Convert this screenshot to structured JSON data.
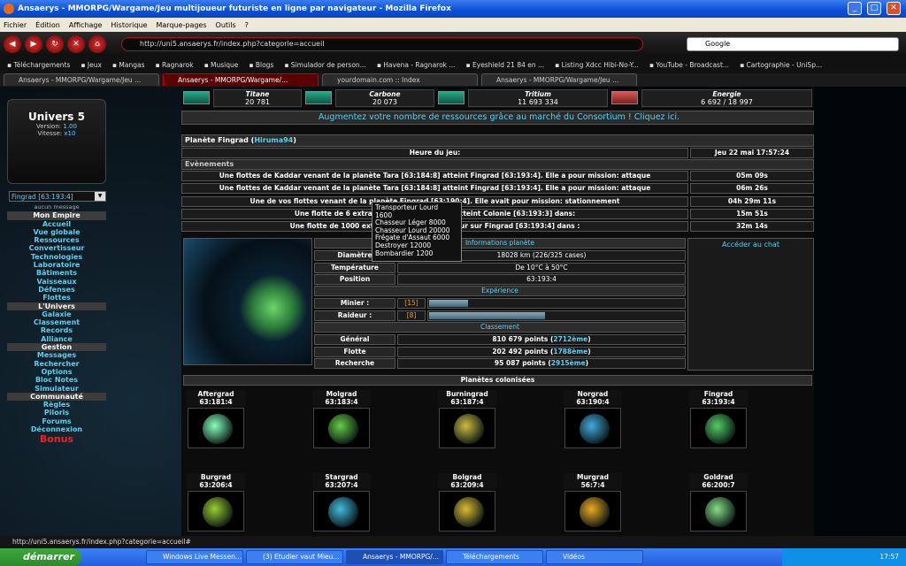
{
  "window": {
    "title": "Ansaerys - MMORPG/Wargame/Jeu multijoueur futuriste en ligne par navigateur - Mozilla Firefox"
  },
  "menu": [
    "Fichier",
    "Édition",
    "Affichage",
    "Historique",
    "Marque-pages",
    "Outils",
    "?"
  ],
  "url": "http://uni5.ansaerys.fr/index.php?categorie=accueil",
  "search_placeholder": "Google",
  "bookmarks": [
    "Téléchargements",
    "Jeux",
    "Mangas",
    "Ragnarok",
    "Musique",
    "Blogs",
    "Simulador de person...",
    "Havena - Ragnarok ...",
    "Eyeshield 21 84 en ...",
    "Listing Xdcc Hibi-No-Y...",
    "YouTube - Broadcast...",
    "Cartographie - UniSp..."
  ],
  "tabs": [
    "Ansaerys - MMORPG/Wargame/Jeu ...",
    "Ansaerys - MMORPG/Wargame/...",
    "yourdomain.com :: Index",
    "Ansaerys - MMORPG/Wargame/Jeu ..."
  ],
  "side": {
    "universe": "Univers 5",
    "version_label": "Version:",
    "version": "1.00",
    "speed_label": "Vitesse:",
    "speed": "x10",
    "planet_select": "Fingrad [63:193:4]",
    "no_message": "aucun message"
  },
  "nav": [
    {
      "t": "h",
      "l": "Mon Empire"
    },
    {
      "t": "i",
      "l": "Accueil"
    },
    {
      "t": "i",
      "l": "Vue globale"
    },
    {
      "t": "i",
      "l": "Ressources"
    },
    {
      "t": "i",
      "l": "Convertisseur"
    },
    {
      "t": "i",
      "l": "Technologies"
    },
    {
      "t": "i",
      "l": "Laboratoire"
    },
    {
      "t": "i",
      "l": "Bâtiments"
    },
    {
      "t": "i",
      "l": "Vaisseaux"
    },
    {
      "t": "i",
      "l": "Défenses"
    },
    {
      "t": "i",
      "l": "Flottes"
    },
    {
      "t": "h",
      "l": "L'Univers"
    },
    {
      "t": "i",
      "l": "Galaxie"
    },
    {
      "t": "i",
      "l": "Classement"
    },
    {
      "t": "i",
      "l": "Records"
    },
    {
      "t": "i",
      "l": "Alliance"
    },
    {
      "t": "h",
      "l": "Gestion"
    },
    {
      "t": "i",
      "l": "Messages"
    },
    {
      "t": "i",
      "l": "Rechercher"
    },
    {
      "t": "i",
      "l": "Options"
    },
    {
      "t": "i",
      "l": "Bloc Notes"
    },
    {
      "t": "i",
      "l": "Simulateur"
    },
    {
      "t": "h",
      "l": "Communauté"
    },
    {
      "t": "i",
      "l": "Règles"
    },
    {
      "t": "i",
      "l": "Piloris"
    },
    {
      "t": "i",
      "l": "Forums"
    },
    {
      "t": "i",
      "l": "Déconnexion"
    },
    {
      "t": "b",
      "l": "Bonus"
    }
  ],
  "resources": [
    {
      "name": "Titane",
      "value": "20 781"
    },
    {
      "name": "Carbone",
      "value": "20 073"
    },
    {
      "name": "Tritium",
      "value": "11 693 334"
    },
    {
      "name": "Energie",
      "value": "6 692 / 18 997"
    }
  ],
  "banner": "Augmentez votre nombre de ressources grâce au marché du Consortium ! Cliquez ici.",
  "planet_title": "Planète Fingrad",
  "planet_owner": "Hiruma94",
  "game_time_label": "Heure du jeu:",
  "game_time": "Jeu 22 mai 17:57:24",
  "events_label": "Evènements",
  "events": [
    {
      "text": "Une flottes de Kaddar venant de la planète Tara [63:184:8] atteint Fingrad [63:193:4]. Elle a pour mission: attaque",
      "time": "05m 09s"
    },
    {
      "text": "Une flottes de Kaddar venant de la planète Tara [63:184:8] atteint Fingrad [63:193:4]. Elle a pour mission: attaque",
      "time": "06m 26s"
    },
    {
      "text": "Une de vos flottes venant de la planète Fingrad [63:190:4]. Elle avait pour mission: stationnement",
      "time": "04h 29m 11s"
    },
    {
      "text": "Une flotte de 6 extracteurs ven [63:193:4] atteint Colonie [63:193:3] dans:",
      "time": "15m 51s"
    },
    {
      "text": "Une flotte de 1000 extracteurs p sera de retour sur Fingrad [63:193:4] dans :",
      "time": "32m 14s"
    }
  ],
  "tooltip": [
    "Transporteur Lourd",
    "1600",
    "Chasseur Léger 8000",
    "Chasseur Lourd 20000",
    "Frégate d'Assaut 6000",
    "Destroyer 12000",
    "Bombardier 1200"
  ],
  "info": {
    "header": "Informations planète",
    "rows": [
      {
        "l": "Diamètre",
        "v": "18028 km (226/325 cases)"
      },
      {
        "l": "Température",
        "v": "De 10°C à 50°C"
      },
      {
        "l": "Position",
        "v": "63:193:4"
      }
    ]
  },
  "experience": {
    "header": "Expérience",
    "rows": [
      {
        "l": "Minier :",
        "lv": "15",
        "fill": 0.15
      },
      {
        "l": "Raideur :",
        "lv": "8",
        "fill": 0.45
      }
    ]
  },
  "ranking": {
    "header": "Classement",
    "rows": [
      {
        "l": "Général",
        "pts": "810 679 points",
        "rank": "2712ème"
      },
      {
        "l": "Flotte",
        "pts": "202 492 points",
        "rank": "1788ème"
      },
      {
        "l": "Recherche",
        "pts": "95 087 points",
        "rank": "2915ème"
      }
    ]
  },
  "chat_link": "Accéder au chat",
  "colonies_label": "Planètes colonisées",
  "colonies": [
    {
      "name": "Aftergrad",
      "coord": "63:181:4",
      "color": "#8fb"
    },
    {
      "name": "Molgrad",
      "coord": "63:183:4",
      "color": "#6c4"
    },
    {
      "name": "Burningrad",
      "coord": "63:187:4",
      "color": "#cb4"
    },
    {
      "name": "Norgrad",
      "coord": "63:190:4",
      "color": "#4ad"
    },
    {
      "name": "Fingrad",
      "coord": "63:193:4",
      "color": "#5c6"
    },
    {
      "name": "Burgrad",
      "coord": "63:206:4",
      "color": "#9c3"
    },
    {
      "name": "Stargrad",
      "coord": "63:207:4",
      "color": "#4bd"
    },
    {
      "name": "Bolgrad",
      "coord": "63:209:4",
      "color": "#db3"
    },
    {
      "name": "Murgrad",
      "coord": "56:7:4",
      "color": "#ea2"
    },
    {
      "name": "Goldrad",
      "coord": "66:200:7",
      "color": "#8d8"
    }
  ],
  "statusbar": "http://uni5.ansaerys.fr/index.php?categorie=accueil#",
  "taskbar": {
    "start": "démarrer",
    "tasks": [
      "Windows Live Messen...",
      "(3) Etudier vaut Mieu...",
      "Ansaerys - MMORPG/...",
      "Téléchargements",
      "Vidéos"
    ],
    "clock": "17:57"
  }
}
